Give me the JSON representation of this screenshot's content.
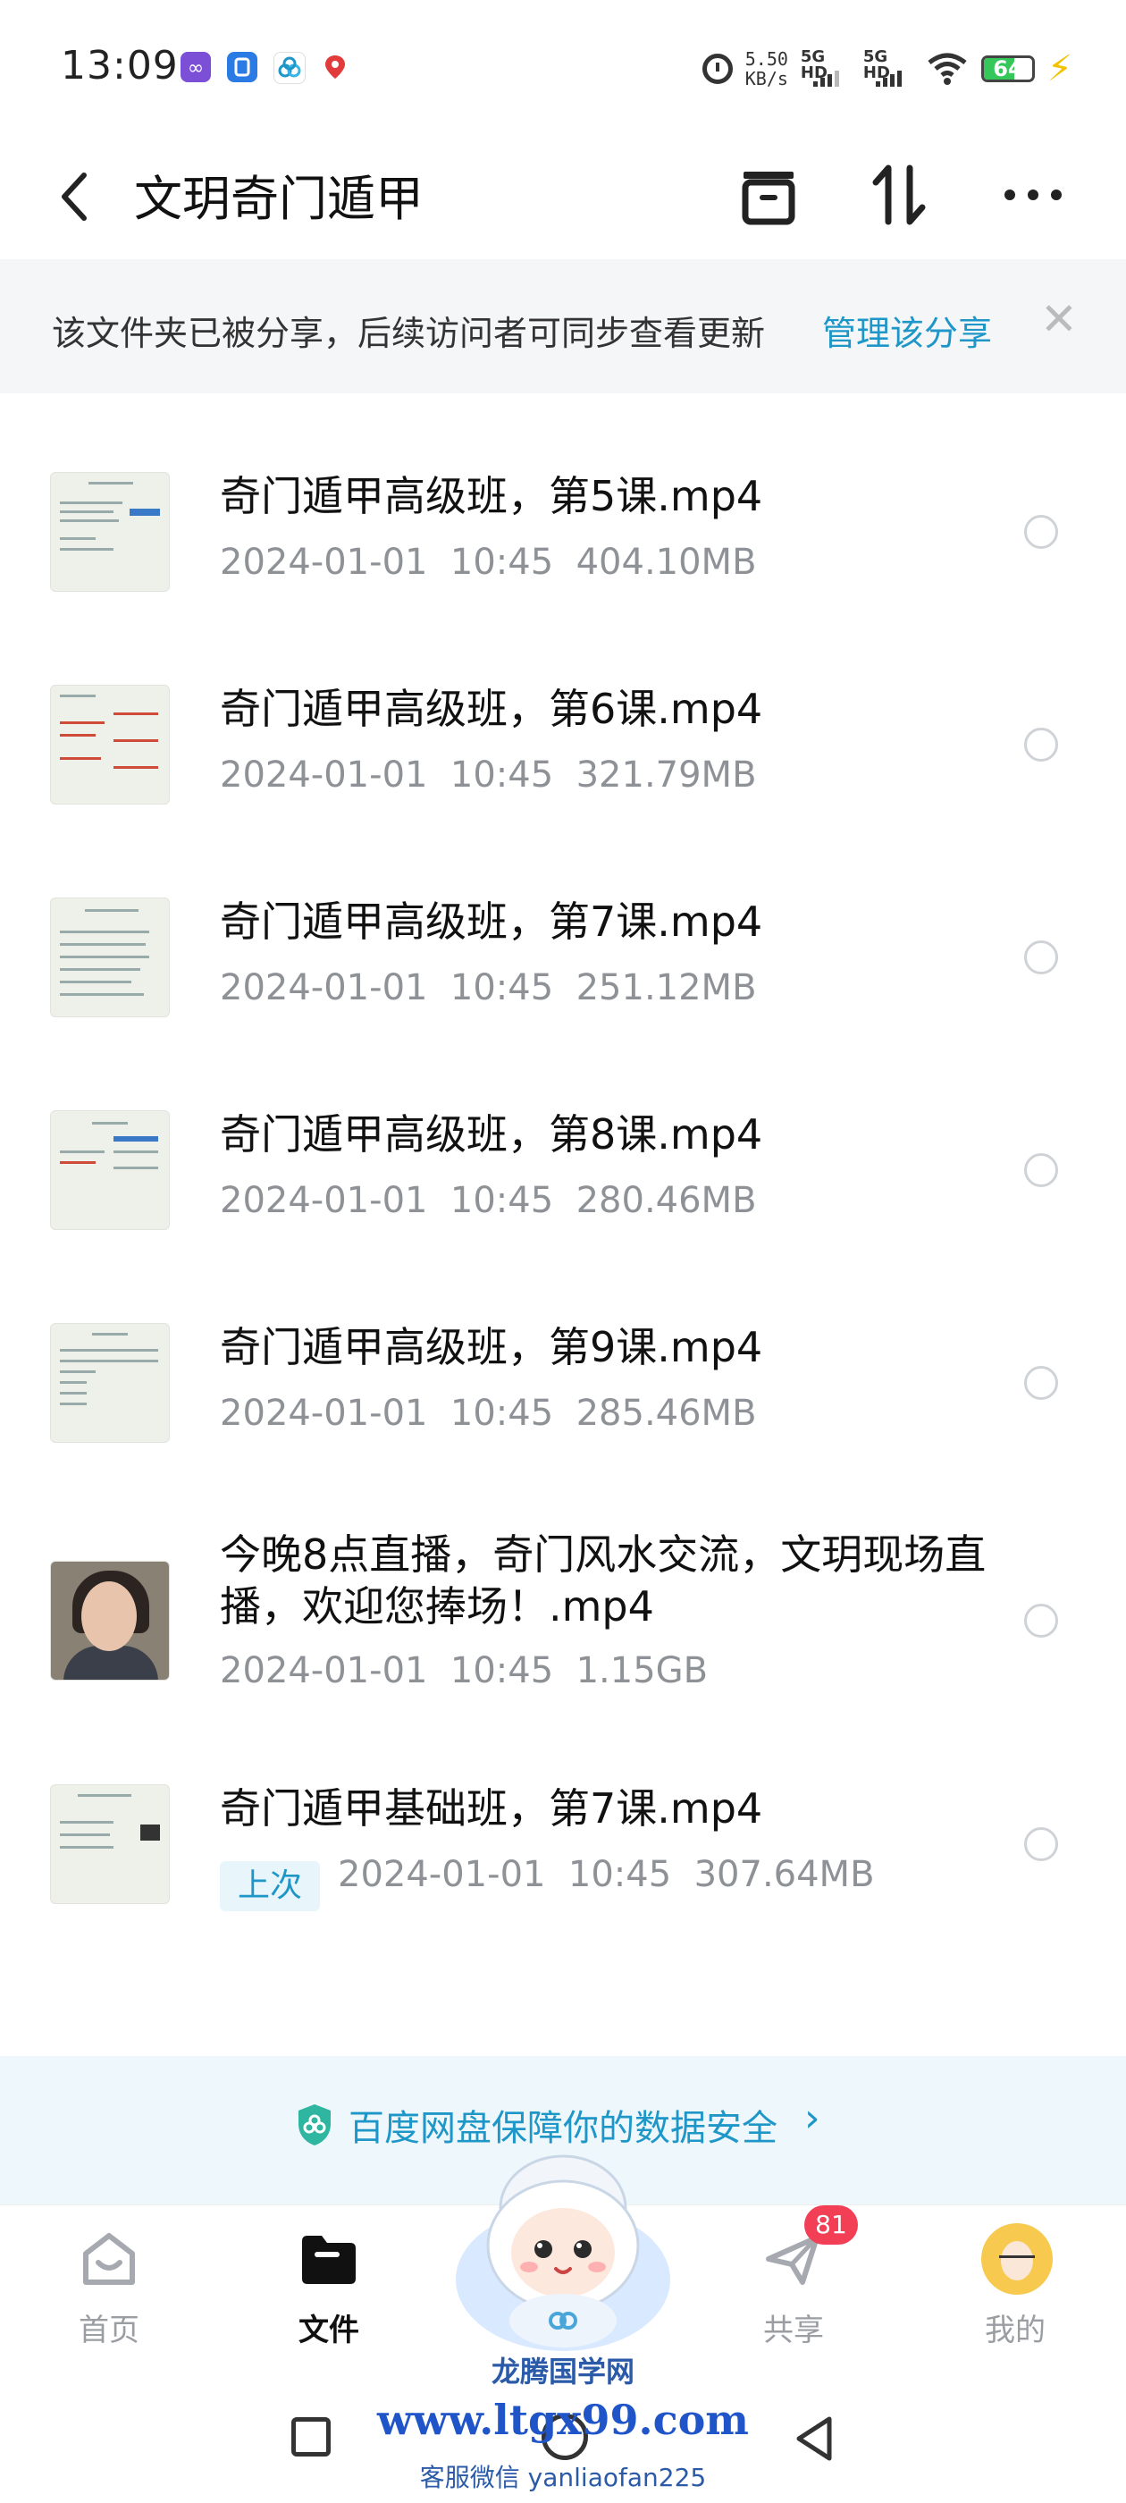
{
  "status_bar": {
    "time": "13:09",
    "net_speed_value": "5.50",
    "net_speed_unit": "KB/s",
    "sim1_label": "5G HD",
    "sim2_label": "5G HD",
    "battery_level": "64",
    "battery_color": "#35c759",
    "app_icons": [
      "infinity-app-icon",
      "shield-app-icon",
      "baidu-netdisk-app-icon",
      "map-pin-app-icon"
    ]
  },
  "header": {
    "title": "文玥奇门遁甲",
    "icons": [
      "back-icon",
      "archive-box-icon",
      "sort-icon",
      "more-icon"
    ]
  },
  "share_banner": {
    "text": "该文件夹已被分享，后续访问者可同步查看更新",
    "link": "管理该分享",
    "close": "✕",
    "link_color": "#1e97c8"
  },
  "files": [
    {
      "name": "奇门遁甲高级班，第5课.mp4",
      "meta": "2024-01-01  10:45  404.10MB"
    },
    {
      "name": "奇门遁甲高级班，第6课.mp4",
      "meta": "2024-01-01  10:45  321.79MB"
    },
    {
      "name": "奇门遁甲高级班，第7课.mp4",
      "meta": "2024-01-01  10:45  251.12MB"
    },
    {
      "name": "奇门遁甲高级班，第8课.mp4",
      "meta": "2024-01-01  10:45  280.46MB"
    },
    {
      "name": "奇门遁甲高级班，第9课.mp4",
      "meta": "2024-01-01  10:45  285.46MB"
    },
    {
      "name": "今晚8点直播，奇门风水交流，文玥现场直播，欢迎您捧场！.mp4",
      "meta": "2024-01-01  10:45  1.15GB"
    },
    {
      "name": "奇门遁甲基础班，第7课.mp4",
      "meta": "2024-01-01  10:45  307.64MB",
      "badge": "上次"
    }
  ],
  "safety_banner": {
    "text": "百度网盘保障你的数据安全",
    "chevron": "›"
  },
  "tabbar": {
    "tabs": [
      {
        "label": "首页",
        "icon": "home-icon"
      },
      {
        "label": "文件",
        "icon": "folder-icon",
        "active": true
      },
      {
        "label": "共享",
        "icon": "paper-plane-icon",
        "badge": "81"
      },
      {
        "label": "我的",
        "icon": "avatar-icon"
      }
    ]
  },
  "watermark": {
    "line1": "龙腾国学网",
    "line2": "www.ltgx99.com",
    "line3": "客服微信 yanliaofan225"
  }
}
